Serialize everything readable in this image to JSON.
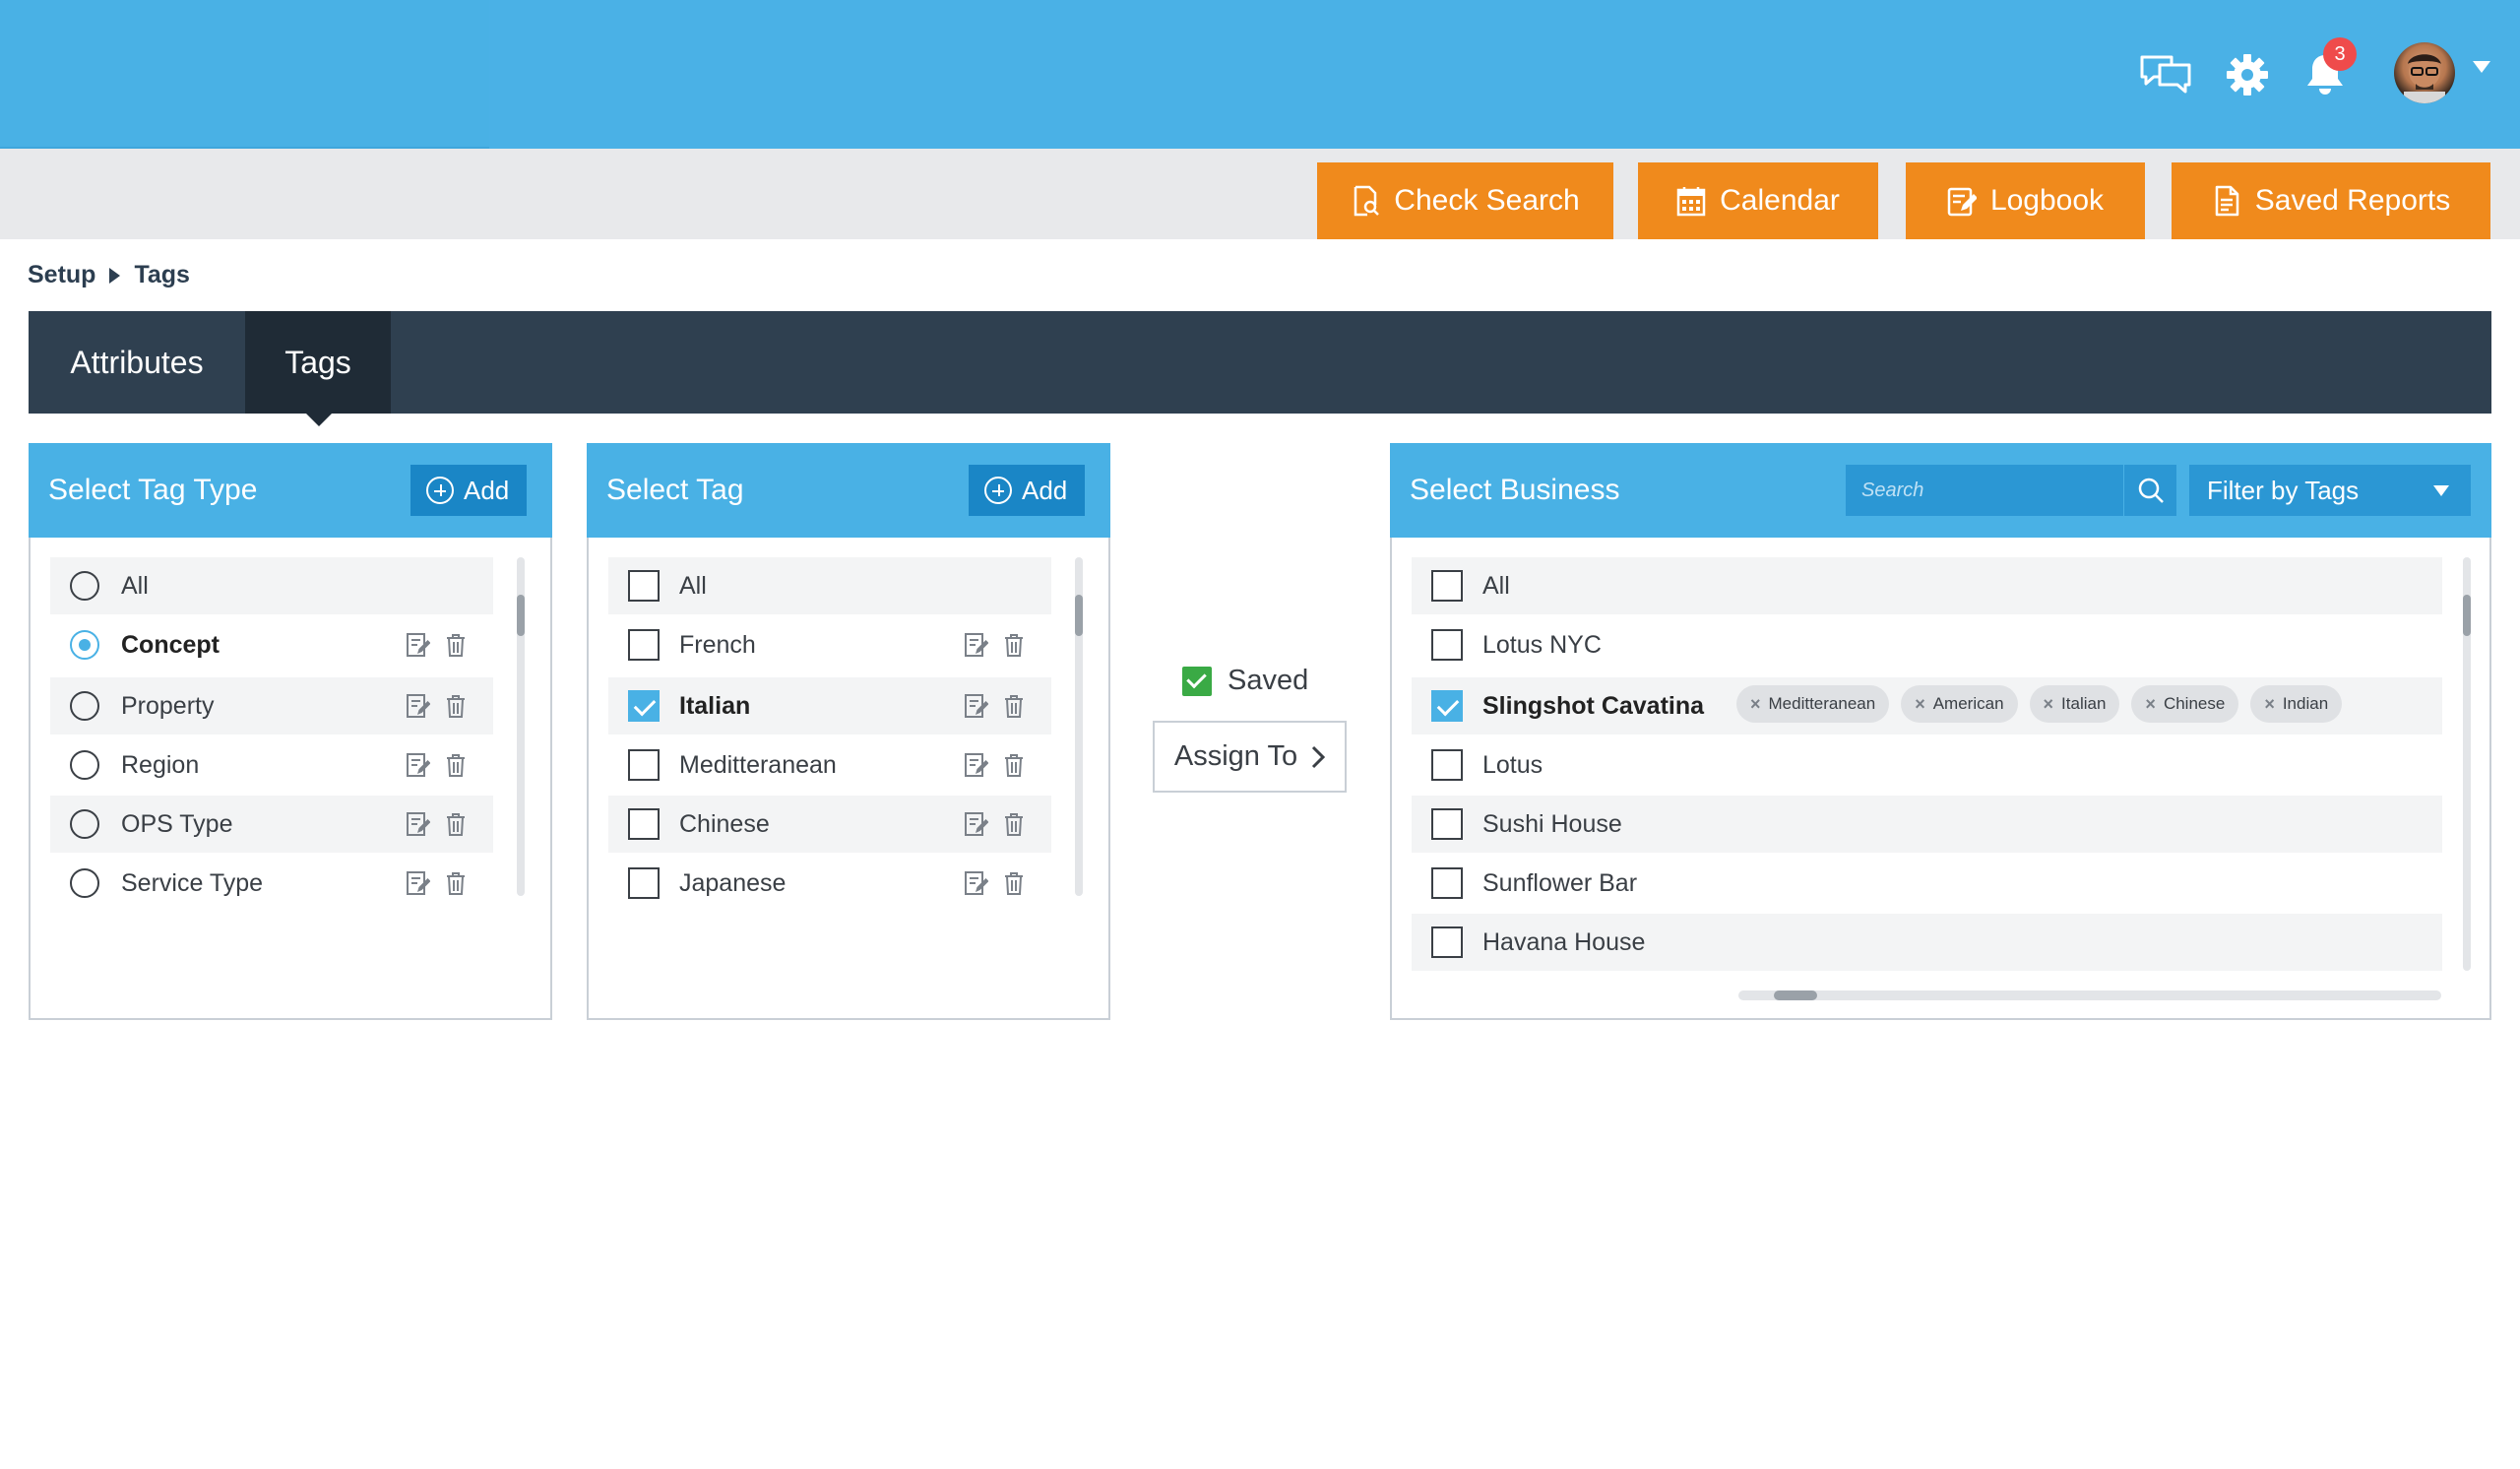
{
  "header": {
    "notifications_count": "3",
    "icons": [
      "chat-icon",
      "gear-icon",
      "bell-icon"
    ]
  },
  "actions": [
    {
      "label": "Check Search",
      "icon": "search-document-icon"
    },
    {
      "label": "Calendar",
      "icon": "calendar-icon"
    },
    {
      "label": "Logbook",
      "icon": "logbook-icon"
    },
    {
      "label": "Saved Reports",
      "icon": "report-icon"
    }
  ],
  "breadcrumb": {
    "parent": "Setup",
    "current": "Tags"
  },
  "tabs": [
    {
      "label": "Attributes",
      "active": false
    },
    {
      "label": "Tags",
      "active": true
    }
  ],
  "tag_type_panel": {
    "title": "Select Tag Type",
    "add_label": "Add",
    "items": [
      {
        "label": "All",
        "selected": false
      },
      {
        "label": "Concept",
        "selected": true
      },
      {
        "label": "Property",
        "selected": false
      },
      {
        "label": "Region",
        "selected": false
      },
      {
        "label": "OPS Type",
        "selected": false
      },
      {
        "label": "Service Type",
        "selected": false
      }
    ]
  },
  "tag_panel": {
    "title": "Select Tag",
    "add_label": "Add",
    "items": [
      {
        "label": "All",
        "checked": false
      },
      {
        "label": "French",
        "checked": false
      },
      {
        "label": "Italian",
        "checked": true
      },
      {
        "label": "Meditteranean",
        "checked": false
      },
      {
        "label": "Chinese",
        "checked": false
      },
      {
        "label": "Japanese",
        "checked": false
      }
    ]
  },
  "middle": {
    "saved_label": "Saved",
    "assign_label": "Assign To"
  },
  "business_panel": {
    "title": "Select Business",
    "search_placeholder": "Search",
    "filter_label": "Filter by Tags",
    "items": [
      {
        "label": "All",
        "checked": false
      },
      {
        "label": "Lotus NYC",
        "checked": false
      },
      {
        "label": "Slingshot Cavatina",
        "checked": true,
        "tags": [
          "Meditteranean",
          "American",
          "Italian",
          "Chinese",
          "Indian"
        ]
      },
      {
        "label": "Lotus",
        "checked": false
      },
      {
        "label": "Sushi House",
        "checked": false
      },
      {
        "label": "Sunflower Bar",
        "checked": false
      },
      {
        "label": "Havana House",
        "checked": false
      }
    ]
  },
  "colors": {
    "primary": "#49b1e5",
    "accent": "#f08a1c",
    "dark": "#2f4050",
    "saved_green": "#3aaa45",
    "badge_red": "#ef4b4b"
  }
}
